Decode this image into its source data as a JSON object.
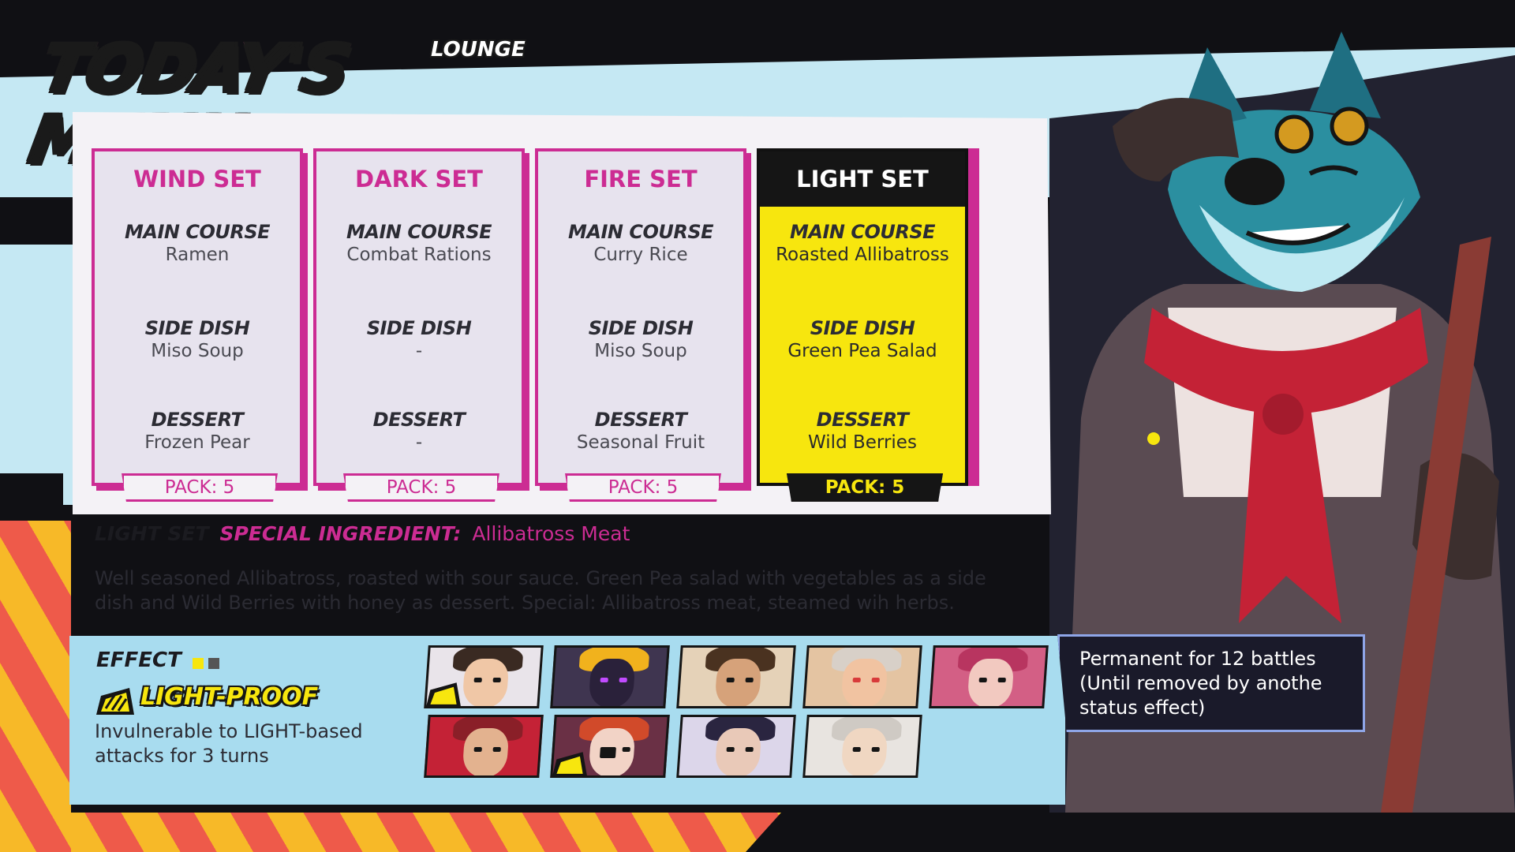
{
  "header": {
    "title": "TODAY'S MENU",
    "subtitle": "LOUNGE"
  },
  "sets": [
    {
      "name": "WIND SET",
      "main_course_label": "MAIN COURSE",
      "main_course": "Ramen",
      "side_dish_label": "SIDE DISH",
      "side_dish": "Miso Soup",
      "dessert_label": "DESSERT",
      "dessert": "Frozen Pear",
      "pack": "PACK: 5",
      "selected": false
    },
    {
      "name": "DARK SET",
      "main_course_label": "MAIN COURSE",
      "main_course": "Combat Rations",
      "side_dish_label": "SIDE DISH",
      "side_dish": "-",
      "dessert_label": "DESSERT",
      "dessert": "-",
      "pack": "PACK: 5",
      "selected": false
    },
    {
      "name": "FIRE SET",
      "main_course_label": "MAIN COURSE",
      "main_course": "Curry Rice",
      "side_dish_label": "SIDE DISH",
      "side_dish": "Miso Soup",
      "dessert_label": "DESSERT",
      "dessert": "Seasonal Fruit",
      "pack": "PACK: 5",
      "selected": false
    },
    {
      "name": "LIGHT SET",
      "main_course_label": "MAIN COURSE",
      "main_course": "Roasted Allibatross",
      "side_dish_label": "SIDE DISH",
      "side_dish": "Green Pea Salad",
      "dessert_label": "DESSERT",
      "dessert": "Wild Berries",
      "pack": "PACK: 5",
      "selected": true
    }
  ],
  "ingredient": {
    "set": "LIGHT SET",
    "label": "SPECIAL INGREDIENT:",
    "value": "Allibatross Meat"
  },
  "description": "Well seasoned Allibatross, roasted with sour sauce. Green Pea salad with vegetables as a side dish and Wild Berries with honey as dessert. Special: Allibatross meat, steamed wih herbs.",
  "effect": {
    "title": "EFFECT",
    "name": "LIGHT-PROOF",
    "description": "Invulnerable to LIGHT-based attacks for 3 turns",
    "icon": "light-proof-icon"
  },
  "tooltip": {
    "text": "Permanent for 12 battles\n(Until removed by anothe\nstatus effect)"
  },
  "colors": {
    "accent_magenta": "#cc2c93",
    "selected_yellow": "#f7e60e",
    "panel_bg": "#f4f2f6",
    "effect_bg": "#a8dcef",
    "tooltip_bg": "#1a1a2a"
  },
  "party": [
    {
      "name": "party-member-1",
      "has_buff": true
    },
    {
      "name": "party-member-2",
      "has_buff": false
    },
    {
      "name": "party-member-3",
      "has_buff": false
    },
    {
      "name": "party-member-4",
      "has_buff": false
    },
    {
      "name": "party-member-5",
      "has_buff": false
    },
    {
      "name": "party-member-6",
      "has_buff": false
    },
    {
      "name": "party-member-7",
      "has_buff": true
    },
    {
      "name": "party-member-8",
      "has_buff": false
    },
    {
      "name": "party-member-9",
      "has_buff": false
    }
  ]
}
